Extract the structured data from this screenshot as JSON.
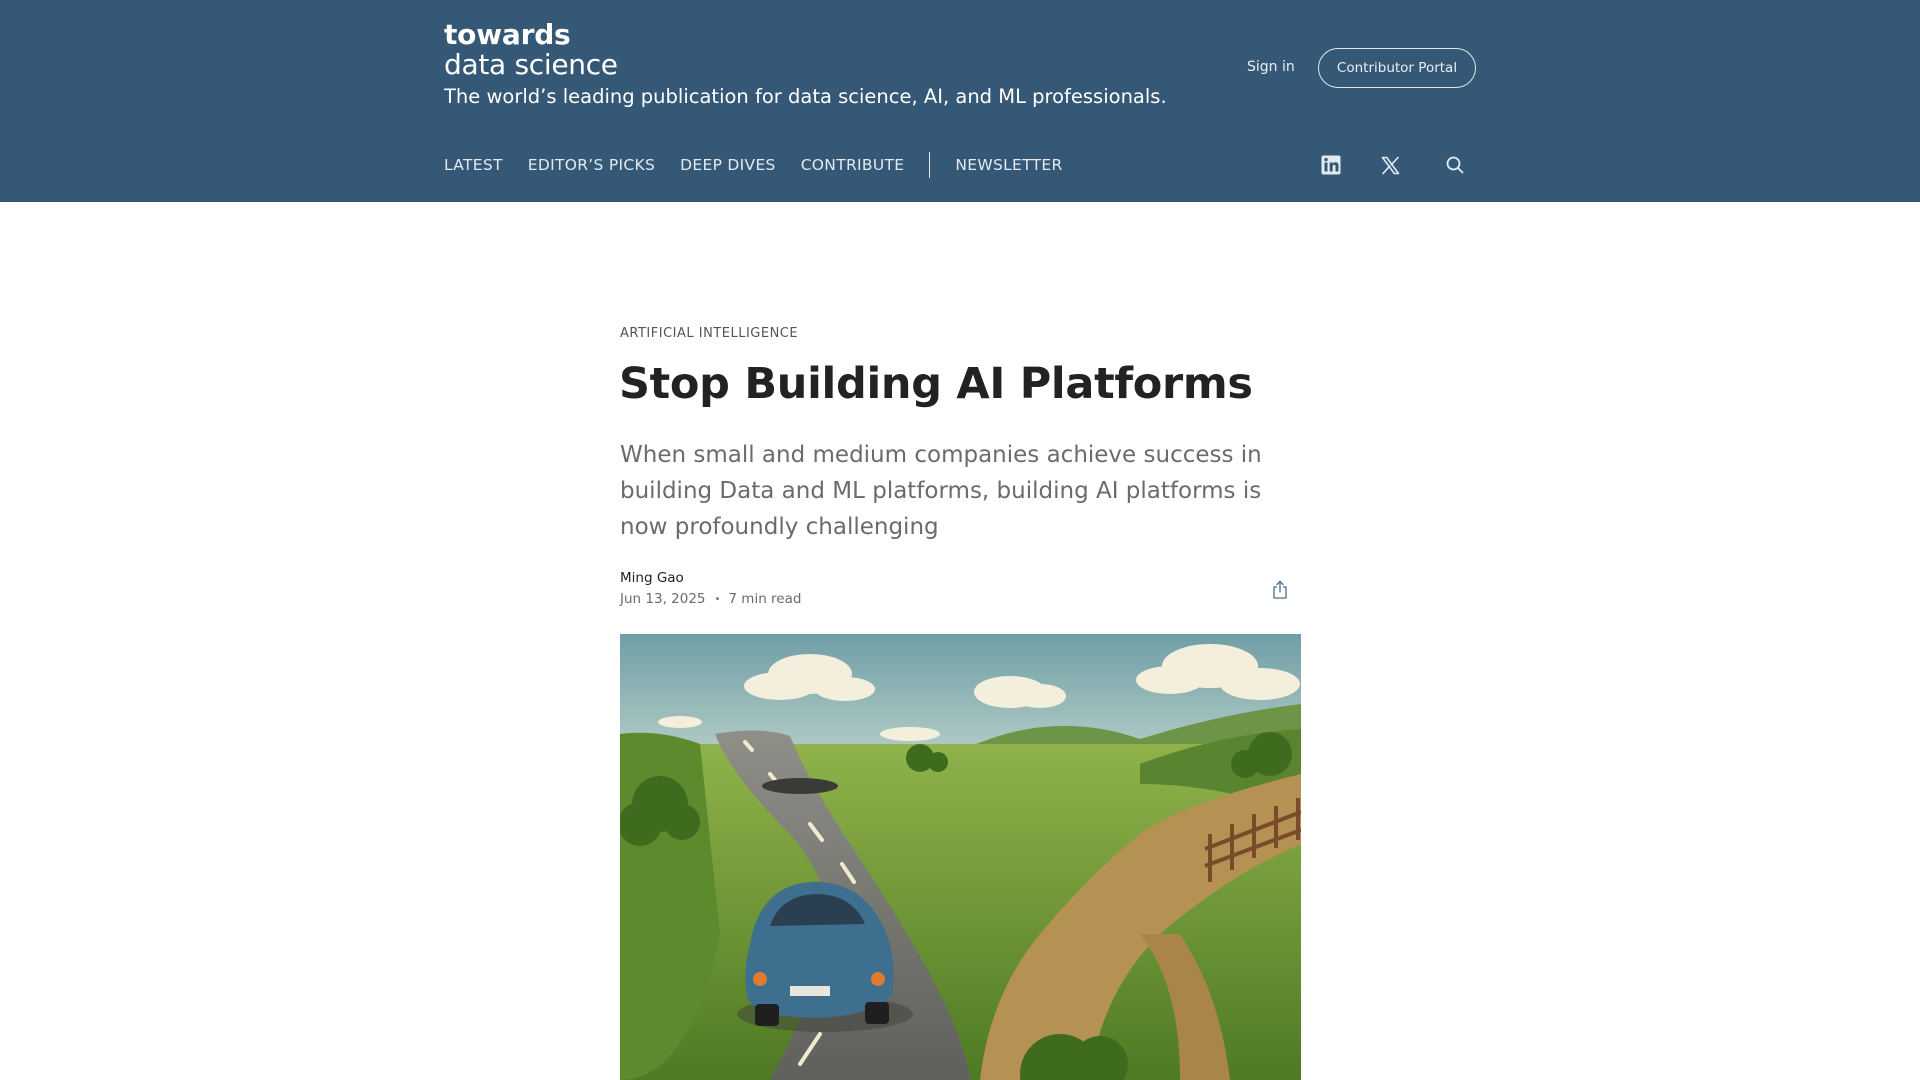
{
  "header": {
    "logo_line1": "towards",
    "logo_line2": "data science",
    "tagline": "The world’s leading publication for data science, AI, and ML professionals.",
    "sign_in": "Sign in",
    "contributor_portal": "Contributor Portal",
    "nav": {
      "latest": "LATEST",
      "editors_picks": "EDITOR’S PICKS",
      "deep_dives": "DEEP DIVES",
      "contribute": "CONTRIBUTE",
      "newsletter": "NEWSLETTER"
    },
    "icons": [
      "linkedin-icon",
      "x-icon",
      "search-icon"
    ]
  },
  "article": {
    "category": "ARTIFICIAL INTELLIGENCE",
    "title": "Stop Building AI Platforms",
    "subtitle": "When small and medium companies achieve success in building Data and ML platforms, building AI platforms is now profoundly challenging",
    "author": "Ming Gao",
    "date": "Jun 13, 2025",
    "read_time": "7 min read",
    "share_icon": "share-icon"
  },
  "colors": {
    "header_bg": "#355876",
    "header_text": "#ffffff",
    "title_text": "#222222",
    "subtitle_text": "#6b6b6b"
  }
}
